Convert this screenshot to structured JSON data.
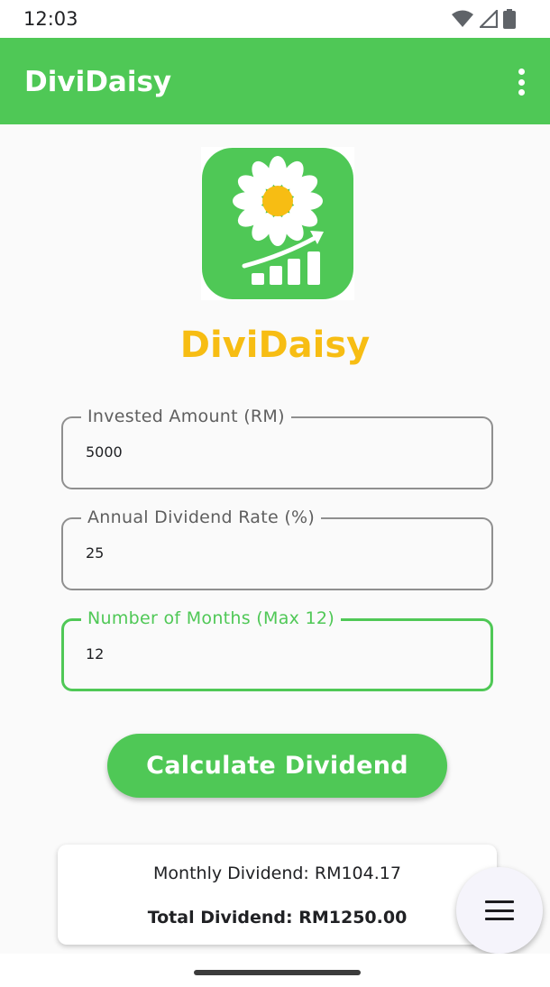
{
  "status_bar": {
    "time": "12:03",
    "icons": [
      "wifi-icon",
      "signal-icon",
      "battery-icon"
    ]
  },
  "app_bar": {
    "title": "DiviDaisy",
    "menu_icon": "more-vert-icon"
  },
  "logo": {
    "heading": "DiviDaisy",
    "colors": {
      "tile": "#4fc856",
      "petals": "#ffffff",
      "center": "#f7bd13",
      "heading": "#f7bd13"
    }
  },
  "form": {
    "invested_amount": {
      "label": "Invested Amount (RM)",
      "value": "5000"
    },
    "dividend_rate": {
      "label": "Annual Dividend Rate (%)",
      "value": "25"
    },
    "months": {
      "label": "Number of Months (Max 12)",
      "value": "12"
    }
  },
  "calculate_label": "Calculate Dividend",
  "result": {
    "monthly": "Monthly Dividend: RM104.17",
    "total": "Total Dividend: RM1250.00"
  },
  "fab_icon": "menu-icon",
  "colors": {
    "accent": "#4fc856",
    "logo_text": "#f7bd13",
    "outline": "#8f8f8f"
  }
}
